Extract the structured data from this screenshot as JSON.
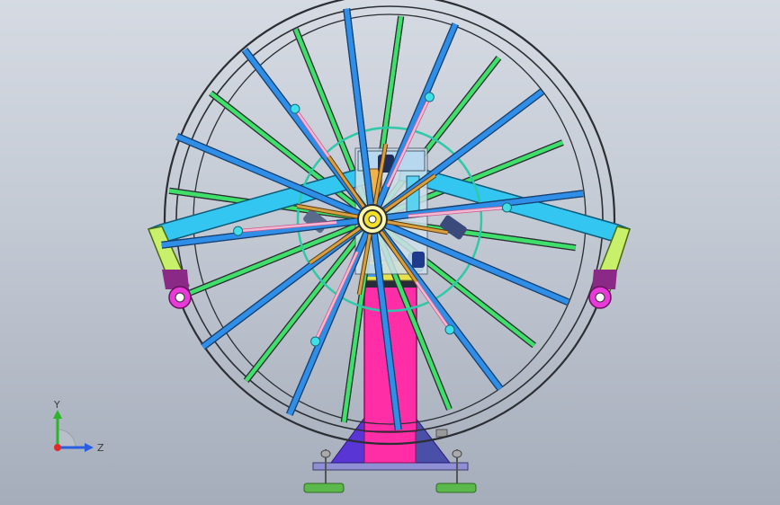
{
  "triad": {
    "y_label": "Y",
    "z_label": "Z"
  },
  "colors": {
    "background_top": "#d5dae3",
    "background_bottom": "#a5adbb",
    "rim": "#2b2f33",
    "spoke_blue": "#2f8fe8",
    "spoke_green": "#3fe06a",
    "arm_cyan": "#33c6f0",
    "post_magenta": "#ff2ea6",
    "base_purple": "#5a35d6",
    "bearing_magenta": "#e83ad8",
    "foot_green": "#5bb84a",
    "hub_yellow": "#f4e12a"
  }
}
